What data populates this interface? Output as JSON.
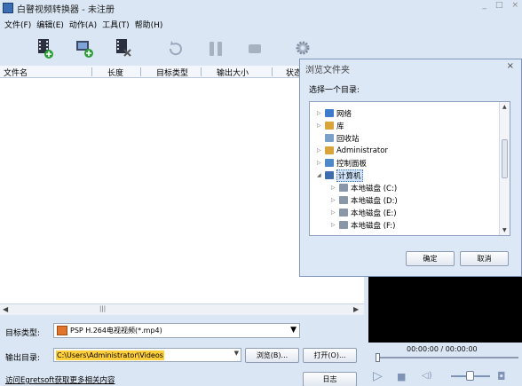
{
  "window": {
    "title": "白瞽视频转换器 - 未注册",
    "minimize": "_",
    "maximize": "□",
    "close": "×"
  },
  "menu": [
    "文件(F)",
    "编辑(E)",
    "动作(A)",
    "工具(T)",
    "帮助(H)"
  ],
  "toolbar_icons": [
    "add-video-icon",
    "add-folder-icon",
    "remove-icon",
    "refresh-icon",
    "pause-icon",
    "stop-icon",
    "settings-icon"
  ],
  "columns": [
    "文件名",
    "长度",
    "目标类型",
    "输出大小",
    "状态"
  ],
  "hscroll": {
    "left": "◀",
    "right": "▶",
    "thumb": "|||"
  },
  "target_type": {
    "label": "目标类型:",
    "value": "PSP H.264电视视频(*.mp4)",
    "arrow": "▼"
  },
  "output": {
    "label": "输出目录:",
    "path": "C:\\Users\\Administrator\\Videos",
    "arrow": "▼",
    "browse": "浏览(B)...",
    "open": "打开(O)..."
  },
  "log_button": "日志",
  "link": "访问Egretsoft获取更多相关内容",
  "player": {
    "timecode": "00:00:00 / 00:00:00",
    "play": "▷",
    "stop": "■",
    "volume": "◁)",
    "snapshot": "◘"
  },
  "dialog": {
    "title": "浏览文件夹",
    "close": "×",
    "prompt": "选择一个目录:",
    "tree": [
      {
        "label": "网络",
        "expander": "▷",
        "icon": "network-icon",
        "color": "#3d7bcc"
      },
      {
        "label": "库",
        "expander": "▷",
        "icon": "library-icon",
        "color": "#d9a43a"
      },
      {
        "label": "回收站",
        "expander": "",
        "icon": "recycle-bin-icon",
        "color": "#7aa0c8"
      },
      {
        "label": "Administrator",
        "expander": "▷",
        "icon": "user-folder-icon",
        "color": "#d9a43a"
      },
      {
        "label": "控制面板",
        "expander": "▷",
        "icon": "control-panel-icon",
        "color": "#4f88c8"
      },
      {
        "label": "计算机",
        "expander": "◢",
        "icon": "computer-icon",
        "color": "#3d6fae"
      },
      {
        "label": "本地磁盘 (C:)",
        "expander": "▷",
        "icon": "drive-c-icon",
        "color": "#8a97a8"
      },
      {
        "label": "本地磁盘 (D:)",
        "expander": "▷",
        "icon": "drive-d-icon",
        "color": "#8a97a8"
      },
      {
        "label": "本地磁盘 (E:)",
        "expander": "▷",
        "icon": "drive-e-icon",
        "color": "#8a97a8"
      },
      {
        "label": "本地磁盘 (F:)",
        "expander": "▷",
        "icon": "drive-f-icon",
        "color": "#8a97a8"
      }
    ],
    "scroll_up": "▲",
    "scroll_down": "▼",
    "ok": "确定",
    "cancel": "取消"
  }
}
